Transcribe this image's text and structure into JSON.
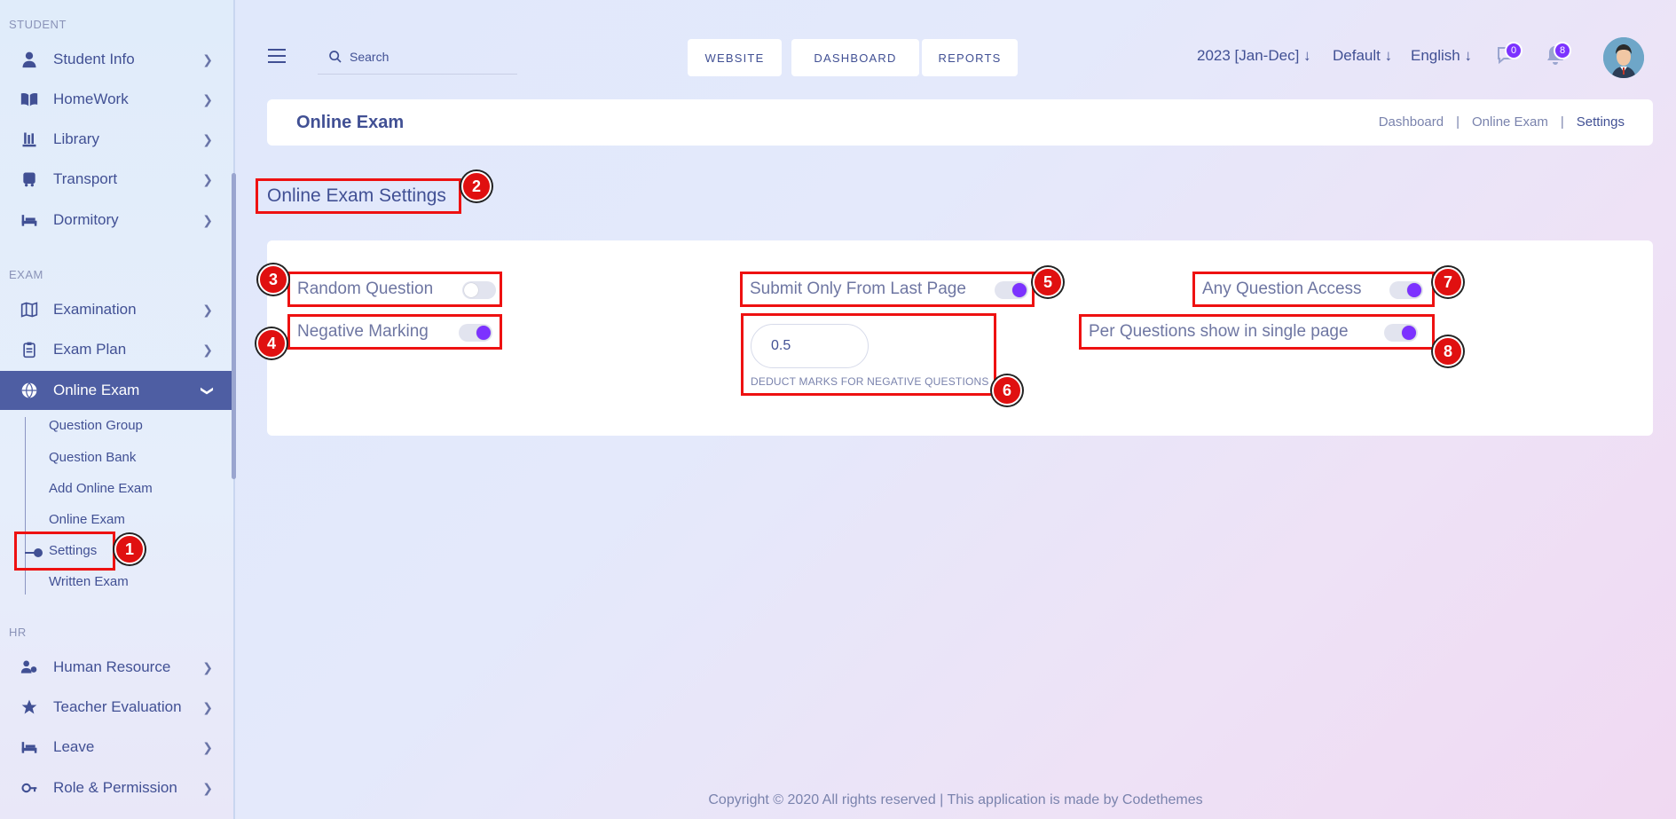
{
  "sidebar": {
    "sections": {
      "student": "STUDENT",
      "exam": "EXAM",
      "hr": "HR"
    },
    "items": {
      "student_info": "Student Info",
      "homework": "HomeWork",
      "library": "Library",
      "transport": "Transport",
      "dormitory": "Dormitory",
      "examination": "Examination",
      "exam_plan": "Exam Plan",
      "online_exam": "Online Exam",
      "human_resource": "Human Resource",
      "teacher_evaluation": "Teacher Evaluation",
      "leave": "Leave",
      "role_permission": "Role & Permission"
    },
    "sub_items": {
      "question_group": "Question Group",
      "question_bank": "Question Bank",
      "add_online_exam": "Add Online Exam",
      "online_exam": "Online Exam",
      "settings": "Settings",
      "written_exam": "Written Exam"
    }
  },
  "topbar": {
    "search_placeholder": "Search",
    "website": "WEBSITE",
    "dashboard": "DASHBOARD",
    "reports": "REPORTS",
    "session": "2023 [Jan-Dec]",
    "theme": "Default",
    "language": "English",
    "messages_count": "0",
    "notifications_count": "8"
  },
  "header": {
    "title": "Online Exam",
    "breadcrumb": [
      "Dashboard",
      "|",
      "Online Exam",
      "|",
      "Settings"
    ]
  },
  "settings": {
    "title": "Online Exam Settings",
    "random_question": {
      "label": "Random Question",
      "enabled": false
    },
    "negative_marking": {
      "label": "Negative Marking",
      "enabled": true
    },
    "submit_last_page": {
      "label": "Submit Only From Last Page",
      "enabled": true
    },
    "any_question_access": {
      "label": "Any Question Access",
      "enabled": true
    },
    "per_questions_single_page": {
      "label": "Per Questions show in single page",
      "enabled": true
    },
    "deduct_marks": {
      "value": "0.5",
      "label": "DEDUCT MARKS FOR NEGATIVE QUESTIONS"
    }
  },
  "markers": [
    "1",
    "2",
    "3",
    "4",
    "5",
    "6",
    "7",
    "8"
  ],
  "footer": "Copyright © 2020 All rights reserved | This application is made by Codethemes",
  "colors": {
    "primary": "#415094",
    "accent": "#7c32ff",
    "marker": "#e01010"
  }
}
